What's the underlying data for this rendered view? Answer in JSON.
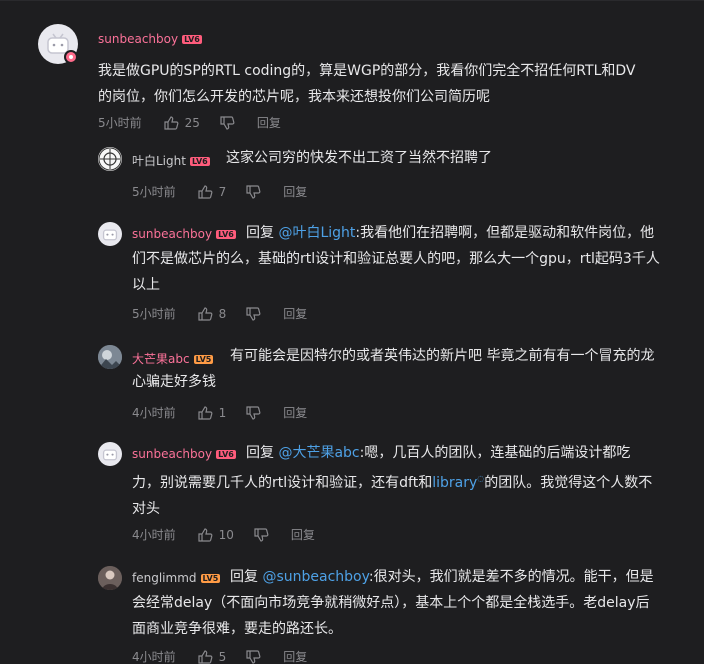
{
  "colors": {
    "background": "#1e1e20",
    "username_pink": "#fb7299",
    "username_gray": "#c9c9cc",
    "mention_blue": "#4ea1e6",
    "meta_gray": "#8a8a8e"
  },
  "root": {
    "username": "sunbeachboy",
    "level": "LV6",
    "text_line1": "我是做GPU的SP的RTL coding的，算是WGP的部分，我看你们完全不招任何RTL和DV",
    "text_line2": "的岗位，你们怎么开发的芯片呢，我本来还想投你们公司简历呢",
    "time": "5小时前",
    "likes": "25",
    "reply_label": "回复"
  },
  "replies": [
    {
      "username": "叶白Light",
      "level": "LV6",
      "text": "这家公司穷的快发不出工资了当然不招聘了",
      "time": "5小时前",
      "likes": "7",
      "reply_label": "回复"
    },
    {
      "username": "sunbeachboy",
      "level": "LV6",
      "prefix": "回复",
      "mention": "@叶白Light",
      "text_line1": ":我看他们在招聘啊，但都是驱动和软件岗位，他",
      "text_line2": "们不是做芯片的么，基础的rtl设计和验证总要人的吧，那么大一个gpu，rtl起码3千人",
      "text_line3": "以上",
      "time": "5小时前",
      "likes": "8",
      "reply_label": "回复"
    },
    {
      "username": "大芒果abc",
      "level": "LV5",
      "text_line1": "有可能会是因特尔的或者英伟达的新片吧 毕竟之前有有一个冒充的龙",
      "text_line2": "心骗走好多钱",
      "time": "4小时前",
      "likes": "1",
      "reply_label": "回复"
    },
    {
      "username": "sunbeachboy",
      "level": "LV6",
      "prefix": "回复",
      "mention": "@大芒果abc",
      "text_line1": ":嗯，几百人的团队，连基础的后端设计都吃",
      "text_line2_a": "力，别说需要几千人的rtl设计和验证，还有dft和",
      "link": "library",
      "text_line2_b": "的团队。我觉得这个人数不",
      "text_line3": "对头",
      "time": "4小时前",
      "likes": "10",
      "reply_label": "回复"
    },
    {
      "username": "fenglimmd",
      "level": "LV5",
      "prefix": "回复",
      "mention": "@sunbeachboy",
      "text_line1": ":很对头，我们就是差不多的情况。能干，但是",
      "text_line2": "会经常delay（不面向市场竞争就稍微好点），基本上个个都是全栈选手。老delay后",
      "text_line3": "面商业竞争很难，要走的路还长。",
      "time": "4小时前",
      "likes": "5",
      "reply_label": "回复"
    }
  ]
}
